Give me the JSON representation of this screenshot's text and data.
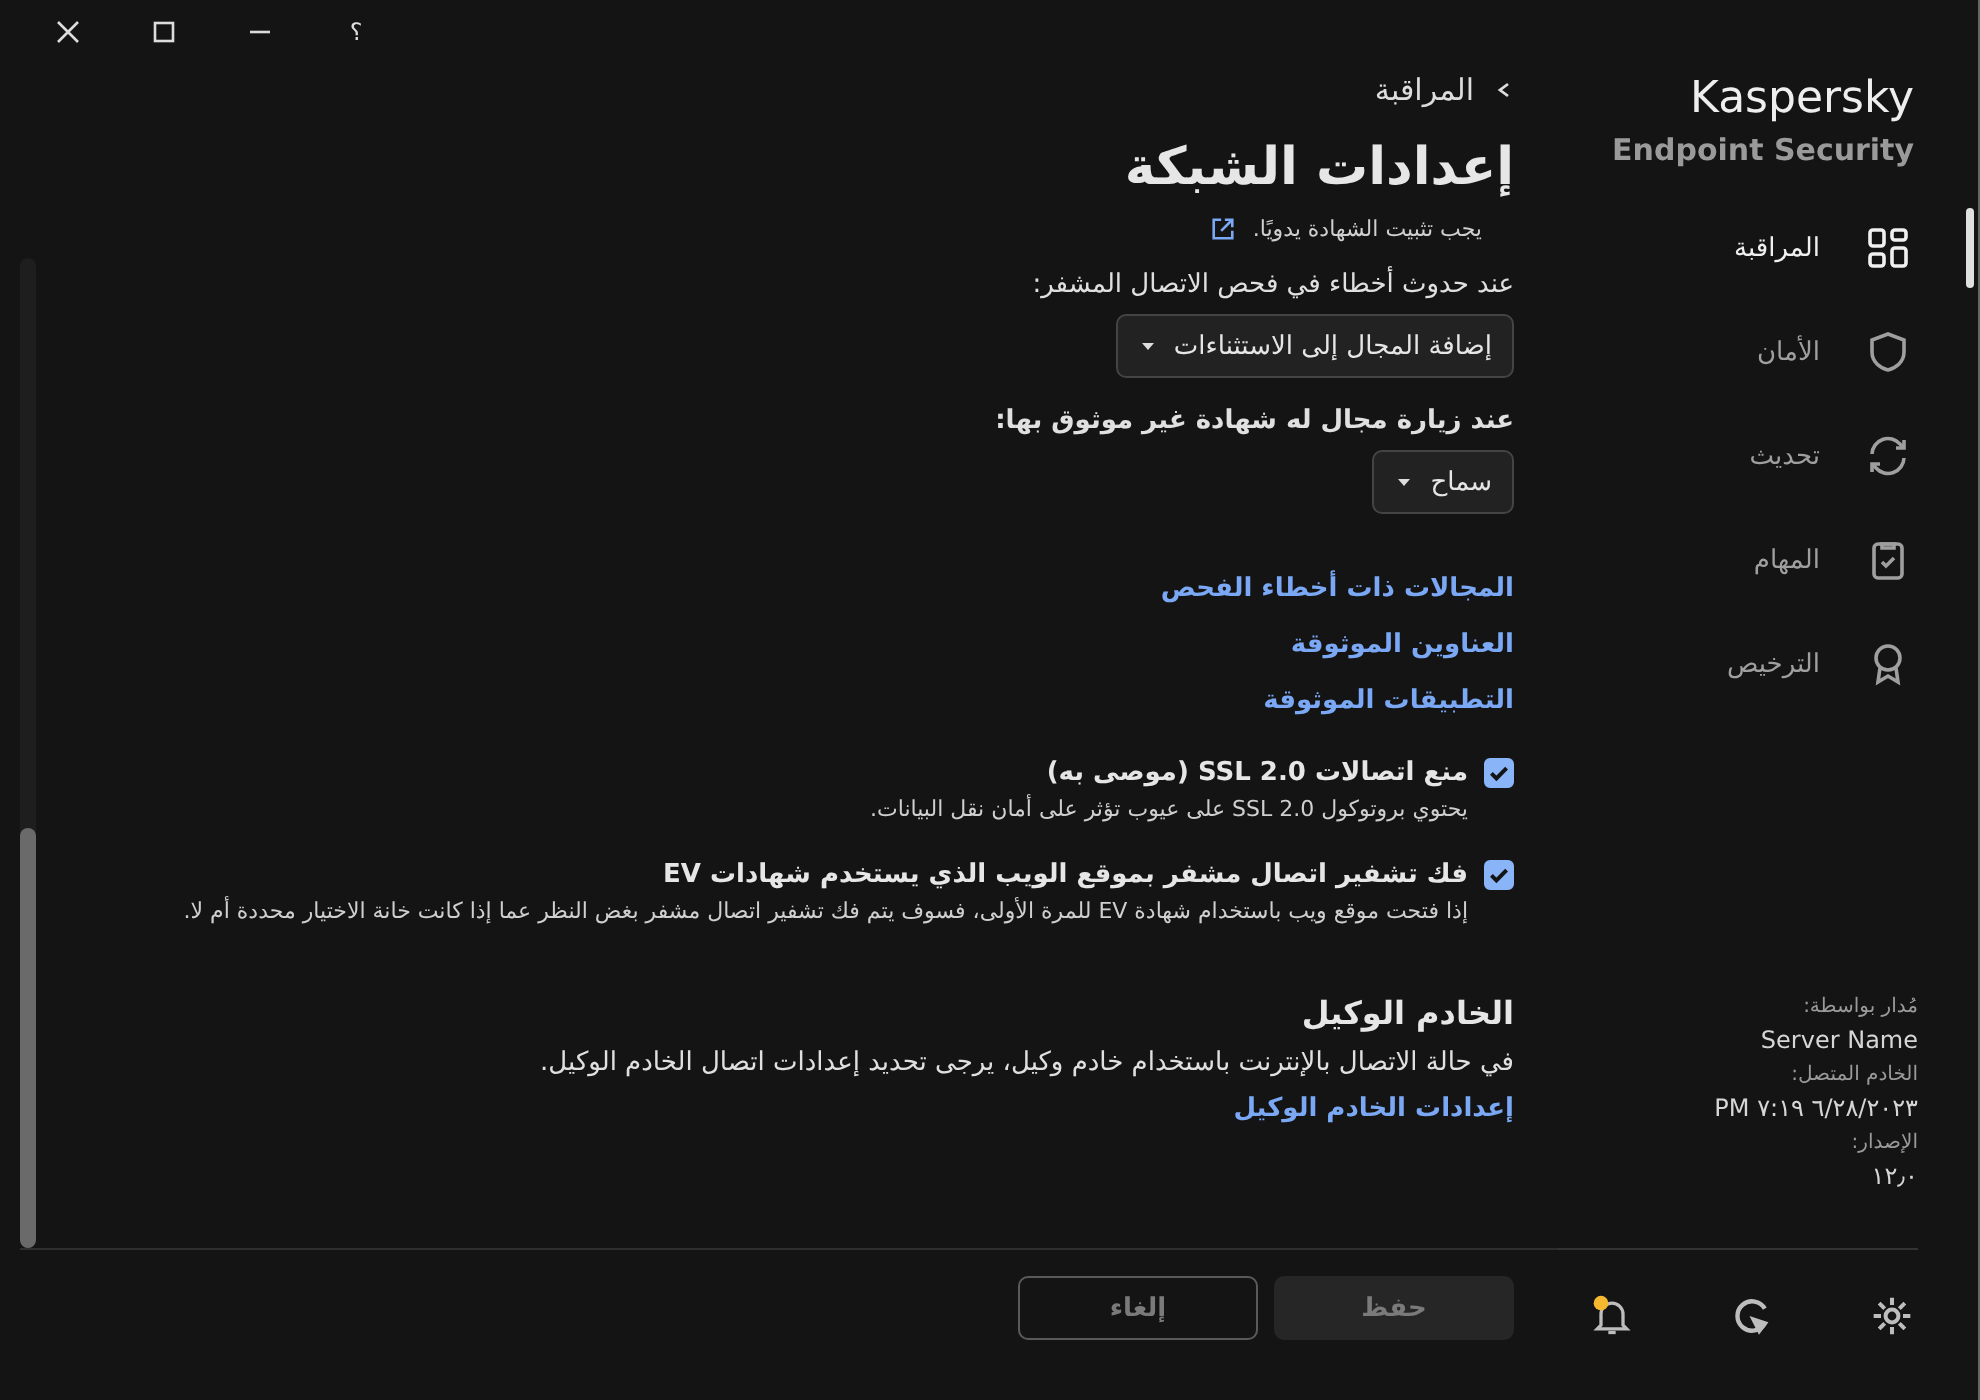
{
  "window_controls": {
    "help": "؟"
  },
  "brand": {
    "name": "Kaspersky",
    "product": "Endpoint Security"
  },
  "nav": [
    {
      "label": "المراقبة",
      "kind": "grid",
      "selected": true
    },
    {
      "label": "الأمان",
      "kind": "shield",
      "selected": false
    },
    {
      "label": "تحديث",
      "kind": "sync",
      "selected": false
    },
    {
      "label": "المهام",
      "kind": "tasks",
      "selected": false
    },
    {
      "label": "الترخيص",
      "kind": "award",
      "selected": false
    }
  ],
  "info": [
    {
      "label": "مُدار بواسطة:",
      "value": "Server Name"
    },
    {
      "label": "الخادم المتصل:",
      "value": "٦/٢٨/٢٠٢٣ ٧:١٩ PM"
    },
    {
      "label": "الإصدار:",
      "value": "١٢٫٠"
    }
  ],
  "sidebar_footer": {
    "notification_unread": true
  },
  "breadcrumb": {
    "back": "المراقبة"
  },
  "title": "إعدادات الشبكة",
  "note": {
    "text": "يجب تثبيت الشهادة يدويًا."
  },
  "dropdowns": [
    {
      "label": "عند حدوث أخطاء في فحص الاتصال المشفر:",
      "bold": false,
      "value": "إضافة المجال إلى الاستثناءات"
    },
    {
      "label": "عند زيارة مجال له شهادة غير موثوق بها:",
      "bold": true,
      "value": "سماح"
    }
  ],
  "links": [
    "المجالات ذات أخطاء الفحص",
    "العناوين الموثوقة",
    "التطبيقات الموثوقة"
  ],
  "checkboxes": [
    {
      "label": "منع اتصالات SSL 2.0 (موصى به)",
      "checked": true,
      "description": "يحتوي بروتوكول SSL 2.0 على عيوب تؤثر على أمان نقل البيانات."
    },
    {
      "label": "فك تشفير اتصال مشفر بموقع الويب الذي يستخدم شهادات EV",
      "checked": true,
      "description": "إذا فتحت موقع ويب باستخدام شهادة EV للمرة الأولى، فسوف يتم فك تشفير اتصال مشفر بغض النظر عما إذا كانت خانة الاختيار محددة أم لا."
    }
  ],
  "proxy": {
    "heading": "الخادم الوكيل",
    "text": "في حالة الاتصال بالإنترنت باستخدام خادم وكيل، يرجى تحديد إعدادات اتصال الخادم الوكيل.",
    "link": "إعدادات الخادم الوكيل"
  },
  "buttons": [
    {
      "label": "حفظ",
      "kind": "primary",
      "disabled": true
    },
    {
      "label": "إلغاء",
      "kind": "secondary",
      "disabled": true
    }
  ]
}
